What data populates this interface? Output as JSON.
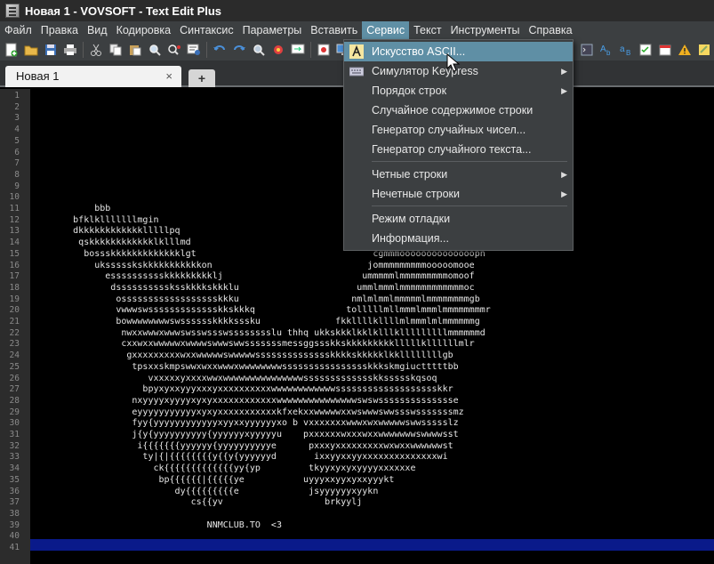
{
  "window": {
    "title": "Новая 1 - VOVSOFT - Text Edit Plus"
  },
  "menubar": {
    "items": [
      "Файл",
      "Правка",
      "Вид",
      "Кодировка",
      "Синтаксис",
      "Параметры",
      "Вставить",
      "Сервис",
      "Текст",
      "Инструменты",
      "Справка"
    ],
    "active": "Сервис"
  },
  "toolbar": {
    "left_icons": [
      "new-file-icon",
      "open-folder-icon",
      "save-icon",
      "print-icon",
      "cut-icon",
      "copy-icon",
      "paste-icon",
      "find-icon",
      "replace-icon",
      "find-in-files-icon",
      "undo-icon",
      "redo-icon",
      "preview-icon",
      "monitor-icon",
      "ascii-art-icon",
      "lock-icon"
    ],
    "right_icons": [
      "terminal-icon",
      "case-upper-icon",
      "case-lower-icon",
      "checklist-icon",
      "calendar-icon",
      "warning-icon",
      "notes-icon"
    ]
  },
  "tabs": [
    {
      "label": "Новая 1",
      "close": "×"
    }
  ],
  "tab_add": "+",
  "editor": {
    "line_numbers": [
      "1",
      "2",
      "3",
      "4",
      "5",
      "6",
      "7",
      "8",
      "9",
      "10",
      "11",
      "12",
      "13",
      "14",
      "15",
      "16",
      "17",
      "18",
      "19",
      "20",
      "21",
      "22",
      "23",
      "24",
      "25",
      "26",
      "27",
      "28",
      "29",
      "30",
      "31",
      "32",
      "33",
      "34",
      "35",
      "36",
      "37",
      "38",
      "39",
      "40",
      "41"
    ],
    "lines": [
      "",
      "",
      "",
      "",
      "",
      "",
      "",
      "",
      "",
      "",
      "            bbb",
      "        bfklklllllllmgin",
      "        dkkkkkkkkkkkklllllpq",
      "         qskkkkkkkkkkkklklllmd",
      "          bossskkkkkkkkkkkkklgt                                 cgmmmoooooooooooooopn",
      "            ukssssskskkkkkkkkkkkon                             jommmmmmmmmooooomooe",
      "              esssssssssskkkkkkkkklj                          ummmmmlmmmmmmmmmomoof",
      "               dssssssssssksskkkkskkklu                      ummlmmmlmmmmmmmmmmmmoc",
      "                osssssssssssssssssskkku                     nmlmlmmlmmmmmlmmmmmmmmgb",
      "                vwwwswssssssssssssskkskkkq                 tolllllmllmmmlmmmlmmmmmmmmr",
      "                bowwwwwwwwswsssssskkkksssku              fkkllllkllllmlmmmlmlmmmmmmg",
      "                 nwxxwwwxwwwswsswssswsssssssslu thhq ukkskkklkklklllklllllllllmmmmmmd",
      "                 cxxwxxwwwwwxwwwwswwwswwsssssssmessggssskkskkkkkkkkklllllkllllllmlr",
      "                  gxxxxxxxxxwxxwwwwwswwwwwsssssssssssssskkkkskkkkklkkllllllllgb",
      "                   tpsxxskmpswwxwxxwwwxwwwwwwwwsssssssssssssssskkkskmgiuctttttbb",
      "                      vxxxxxyxxxxwwxwwwwwwwwwwwwwwwssssssssssssskkssssskqsoq",
      "                     bpyxyxxyyyxxxyxxxxxxxxxxwwwwwwwwwwwwssssssssssssssssssskkr",
      "                   nxyyyyxyyyyxyxyxxxxxxxxxxxxwwwwwwwwwwwwwwwswswsssssssssssssse",
      "                   eyyyyyyyyyyyxyxyxxxxxxxxxxxkfxekxxwwwwwxxwswwwswwssswsssssssmz",
      "                   fyy{yyyyyyyyyyyyxyyxxyyyyyyxo b vxxxxxxxwwwxwxwwwwwswwssssslz",
      "                   j{y{yyyyyyyyyy{yyyyyyxyyyyyu    pxxxxxxwxxxwxxwwwwwwwswwwwsst",
      "                    i{{{{{{{yyyyyy{yyyyyyyyyye      pxxxyxxxxxxxxxwxwxxwwwwwwst",
      "                     ty|{|{{{{{{{{y{{y{yyyyyyd       ixxyyxxyyxxxxxxxxxxxxxxwi",
      "                       ck{{{{{{{{{{{{{yy{yp         tkyyxyxyxyyyyxxxxxxe",
      "                        bp{{{{{{|{{{{{ye           uyyyxxyyxyxxyyykt",
      "                           dy{{{{{{{{{e             jsyyyyyyxyykn",
      "                              cs{{yv                   brkyylj",
      "",
      "                                 NNMCLUB.TO  <3",
      "",
      ""
    ]
  },
  "service_menu": {
    "items": [
      {
        "label": "Искусство ASCII...",
        "icon": "ascii-art-icon",
        "submenu": false,
        "highlighted": true
      },
      {
        "label": "Симулятор Keypress",
        "icon": "keyboard-icon",
        "submenu": true,
        "highlighted": false
      },
      {
        "label": "Порядок строк",
        "icon": "",
        "submenu": true,
        "highlighted": false
      },
      {
        "label": "Случайное содержимое строки",
        "icon": "",
        "submenu": false,
        "highlighted": false
      },
      {
        "label": "Генератор случайных чисел...",
        "icon": "",
        "submenu": false,
        "highlighted": false
      },
      {
        "label": "Генератор случайного текста...",
        "icon": "",
        "submenu": false,
        "highlighted": false
      },
      {
        "label": "Четные строки",
        "icon": "",
        "submenu": true,
        "highlighted": false
      },
      {
        "label": "Нечетные строки",
        "icon": "",
        "submenu": true,
        "highlighted": false
      },
      {
        "label": "Режим отладки",
        "icon": "",
        "submenu": false,
        "highlighted": false
      },
      {
        "label": "Информация...",
        "icon": "",
        "submenu": false,
        "highlighted": false
      }
    ],
    "submenu_arrow": "▶"
  },
  "colors": {
    "accent": "#5f8fa5",
    "menubar_bg": "#3c3f41",
    "editor_bg": "#000000",
    "current_line": "#0a1a8a"
  }
}
